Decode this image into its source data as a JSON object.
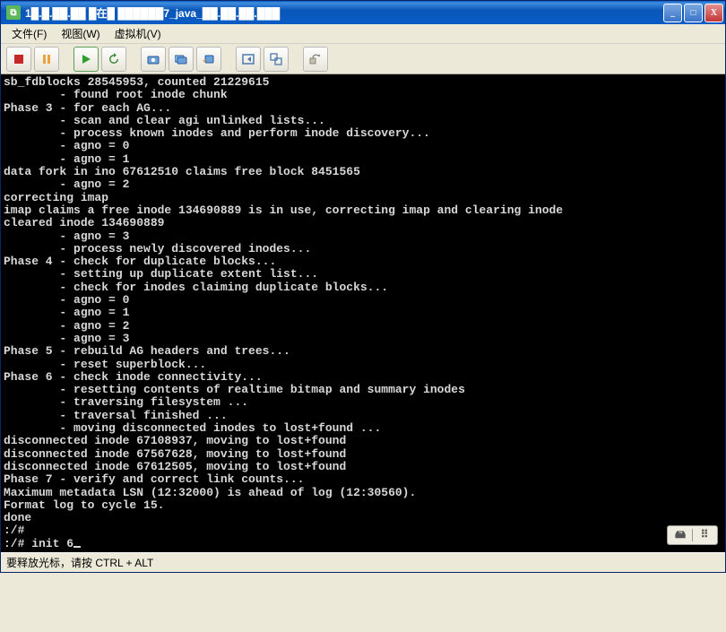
{
  "window": {
    "title": "1█.█.██.██ █在█ ██████7_java_██.██.██.███",
    "icon_glyph": "⧉"
  },
  "win_buttons": {
    "min": "_",
    "max": "□",
    "close": "X"
  },
  "menu": {
    "file": "文件(F)",
    "view": "视图(W)",
    "vm": "虚拟机(V)"
  },
  "toolbar": {
    "stop": "stop",
    "pause": "pause",
    "play": "play",
    "refresh": "refresh",
    "snap": "snapshot",
    "snapmgr": "snapshot-manager",
    "revert": "revert",
    "fullscreen": "fullscreen",
    "unity": "unity",
    "devices": "devices"
  },
  "console_lines": [
    "sb_fdblocks 28545953, counted 21229615",
    "        - found root inode chunk",
    "Phase 3 - for each AG...",
    "        - scan and clear agi unlinked lists...",
    "        - process known inodes and perform inode discovery...",
    "        - agno = 0",
    "        - agno = 1",
    "data fork in ino 67612510 claims free block 8451565",
    "        - agno = 2",
    "correcting imap",
    "imap claims a free inode 134690889 is in use, correcting imap and clearing inode",
    "cleared inode 134690889",
    "        - agno = 3",
    "        - process newly discovered inodes...",
    "Phase 4 - check for duplicate blocks...",
    "        - setting up duplicate extent list...",
    "        - check for inodes claiming duplicate blocks...",
    "        - agno = 0",
    "        - agno = 1",
    "        - agno = 2",
    "        - agno = 3",
    "Phase 5 - rebuild AG headers and trees...",
    "        - reset superblock...",
    "Phase 6 - check inode connectivity...",
    "        - resetting contents of realtime bitmap and summary inodes",
    "        - traversing filesystem ...",
    "        - traversal finished ...",
    "        - moving disconnected inodes to lost+found ...",
    "disconnected inode 67108937, moving to lost+found",
    "disconnected inode 67567628, moving to lost+found",
    "disconnected inode 67612505, moving to lost+found",
    "Phase 7 - verify and correct link counts...",
    "Maximum metadata LSN (12:32000) is ahead of log (12:30560).",
    "Format log to cycle 15.",
    "done",
    ":/#",
    ":/# init 6"
  ],
  "float": {
    "drive_glyph": "🖴",
    "menu_glyph": "⠿"
  },
  "statusbar": {
    "text": "要释放光标，请按 CTRL + ALT"
  }
}
